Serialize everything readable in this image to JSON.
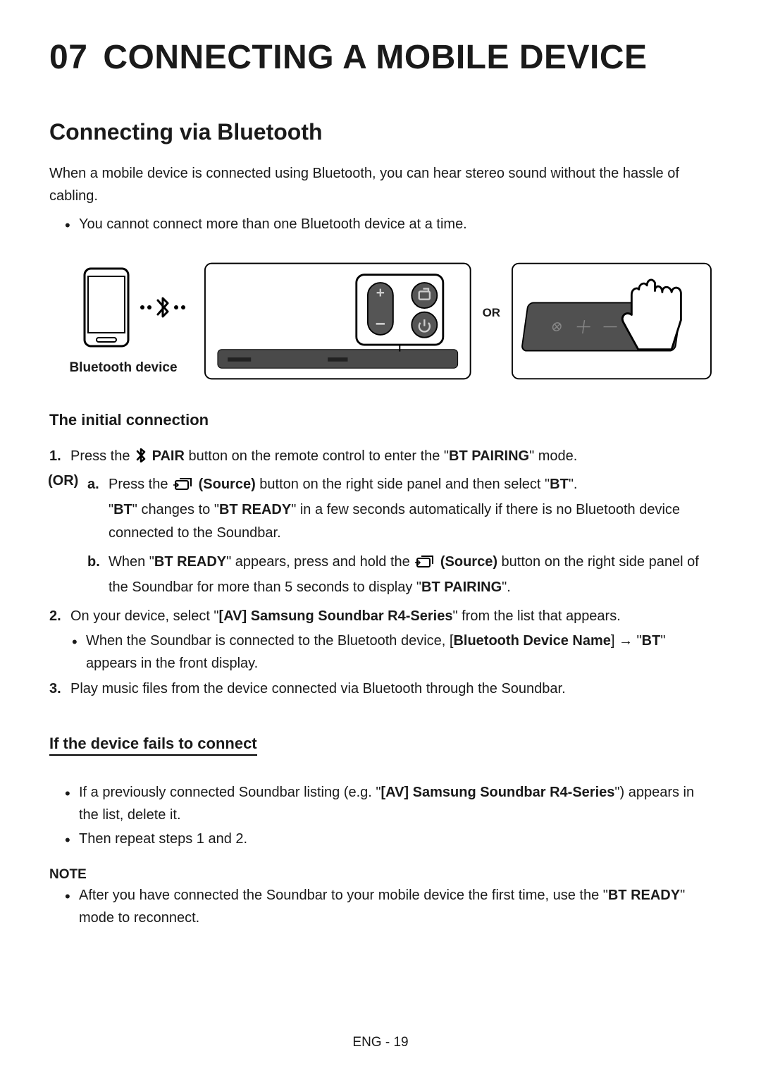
{
  "chapter": {
    "num": "07",
    "title": "CONNECTING A MOBILE DEVICE"
  },
  "section_title": "Connecting via Bluetooth",
  "intro_text": "When a mobile device is connected using Bluetooth, you can hear stereo sound without the hassle of cabling.",
  "intro_bullet": "You cannot connect more than one Bluetooth device at a time.",
  "diagram": {
    "phone_label": "Bluetooth device",
    "or_label": "OR"
  },
  "initial": {
    "heading": "The initial connection",
    "step1": {
      "pre": "Press the ",
      "pair_label": "PAIR",
      "post": " button on the remote control to enter the \"",
      "mode": "BT PAIRING",
      "end": "\" mode."
    },
    "or_label": "(OR)",
    "step_a": {
      "marker": "a.",
      "pre": "Press the ",
      "source_label": "(Source)",
      "mid": " button on the right side panel and then select \"",
      "bt": "BT",
      "end": "\".",
      "line2_q1": "\"",
      "line2_bt": "BT",
      "line2_mid": "\" changes to \"",
      "line2_ready": "BT READY",
      "line2_end": "\" in a few seconds automatically if there is no Bluetooth device connected to the Soundbar."
    },
    "step_b": {
      "marker": "b.",
      "pre": "When \"",
      "ready": "BT READY",
      "mid": "\" appears, press and hold the ",
      "source_label": "(Source)",
      "post": " button on the right side panel of the Soundbar for more than 5 seconds to display \"",
      "pairing": "BT PAIRING",
      "end": "\"."
    },
    "step2": {
      "pre": "On your device, select \"",
      "device": "[AV] Samsung Soundbar R4-Series",
      "post": "\" from the list that appears."
    },
    "step2_bullet": {
      "pre": "When the Soundbar is connected to the Bluetooth device, [",
      "name": "Bluetooth Device Name",
      "mid": "] → \"",
      "bt": "BT",
      "end": "\" appears in the front display."
    },
    "step3": "Play music files from the device connected via Bluetooth through the Soundbar."
  },
  "fails": {
    "heading": "If the device fails to connect",
    "b1": {
      "pre": "If a previously connected Soundbar listing (e.g. \"",
      "device": "[AV] Samsung Soundbar R4-Series",
      "post": "\") appears in the list, delete it."
    },
    "b2": "Then repeat steps 1 and 2."
  },
  "note": {
    "label": "NOTE",
    "b1": {
      "pre": "After you have connected the Soundbar to your mobile device the first time, use the \"",
      "ready": "BT READY",
      "post": "\" mode to reconnect."
    }
  },
  "footer": "ENG - 19"
}
